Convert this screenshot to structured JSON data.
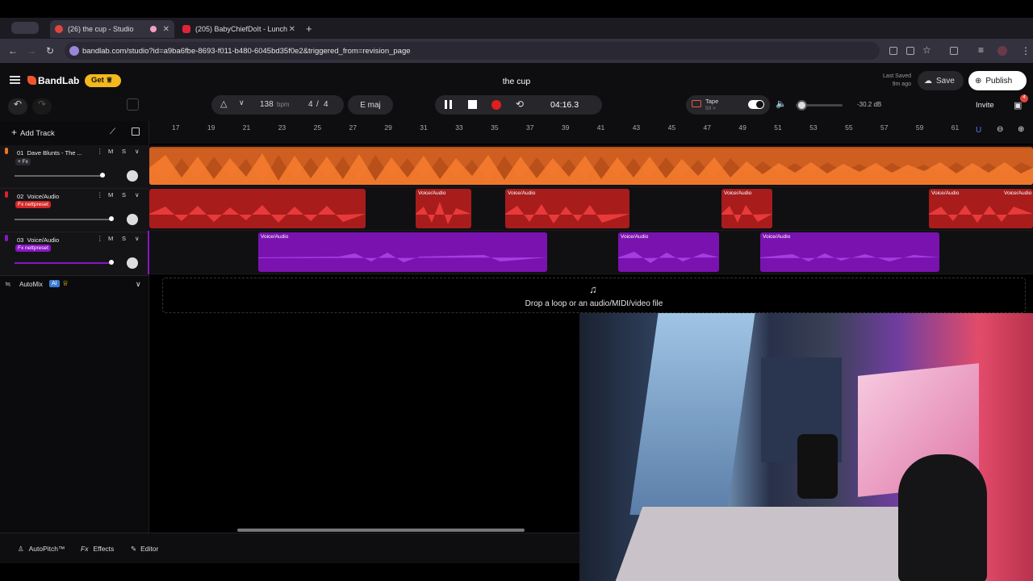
{
  "browser": {
    "tabs": [
      {
        "title": "(26) the cup - Studio",
        "favicon_color": "#e0443a"
      },
      {
        "title": "(205) BabyChiefDoIt - Lunch",
        "favicon_color": "#e0233a"
      }
    ],
    "url": "bandlab.com/studio?id=a9ba6fbe-8693-f011-b480-6045bd35f0e2&triggered_from=revision_page"
  },
  "app": {
    "brand": "BandLab",
    "get_label": "Get",
    "project_title": "the cup",
    "last_saved_label": "Last Saved",
    "last_saved_time": "9m ago",
    "save_label": "Save",
    "publish_label": "Publish",
    "invite_label": "Invite",
    "gift_badge": "4",
    "accent": "#f0562d"
  },
  "transport": {
    "bpm": "138",
    "bpm_unit": "bpm",
    "time_sig_num": "4",
    "time_sig_sep": "/",
    "time_sig_den": "4",
    "key": "E maj",
    "time": "04:16.3",
    "tape_label": "Tape",
    "tape_value": "50 >",
    "volume_db": "-30.2 dB",
    "volume_level": 0.05
  },
  "ruler": [
    "17",
    "19",
    "21",
    "23",
    "25",
    "27",
    "29",
    "31",
    "33",
    "35",
    "37",
    "39",
    "41",
    "43",
    "45",
    "47",
    "49",
    "51",
    "53",
    "55",
    "57",
    "59",
    "61"
  ],
  "left": {
    "add_track_label": "Add Track",
    "automix_label": "AutoMix",
    "ai_badge": "AI"
  },
  "tracks": [
    {
      "num": "01",
      "name": "Dave Blunts - The ...",
      "fx": "+ Fx",
      "m": "M",
      "s": "S",
      "color": "#f07323",
      "volume": 0.8,
      "clips": []
    },
    {
      "num": "02",
      "name": "Voice/Audio",
      "fx": "Fx  nettpreset",
      "m": "M",
      "s": "S",
      "color": "#d42626",
      "clips": [
        "Voice/Audio",
        "Voice/Audio",
        "Voice/Audio",
        "Voice/Audio",
        "Voice/Audio"
      ]
    },
    {
      "num": "03",
      "name": "Voice/Audio",
      "fx": "Fx  nettpreset",
      "m": "M",
      "s": "S",
      "color": "#8a14c4",
      "clips": [
        "Voice/Audio",
        "Voice/Audio",
        "Voice/Audio"
      ]
    }
  ],
  "dropzone_text": "Drop a loop or an audio/MIDI/video file",
  "bottom": {
    "autopitch": "AutoPitch™",
    "effects_prefix": "Fx",
    "effects": "Effects",
    "editor": "Editor"
  },
  "icons": {
    "hamburger": "menu-icon",
    "undo": "undo-icon",
    "redo": "redo-icon",
    "pause": "pause-icon",
    "stop": "stop-icon",
    "record": "record-icon",
    "loop": "loop-icon"
  }
}
